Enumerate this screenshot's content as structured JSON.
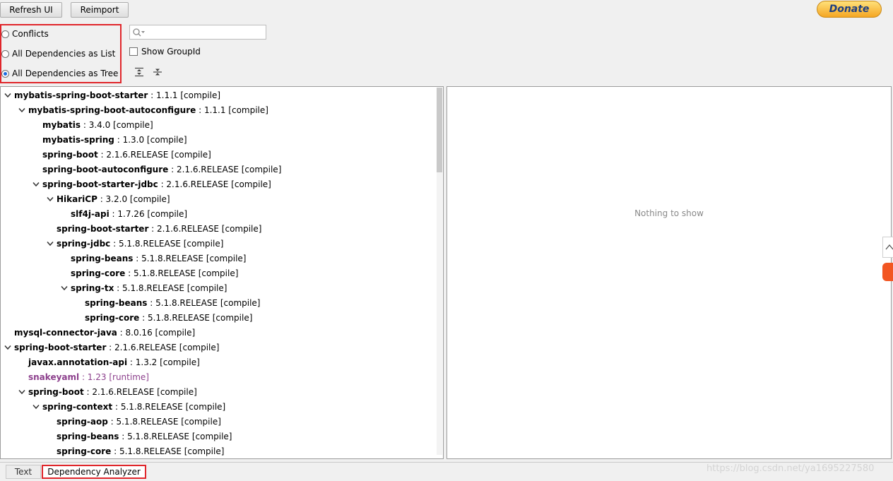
{
  "toolbar": {
    "refresh_label": "Refresh UI",
    "reimport_label": "Reimport",
    "donate_label": "Donate"
  },
  "view_mode": {
    "options": [
      "Conflicts",
      "All Dependencies as List",
      "All Dependencies as Tree"
    ],
    "selected": "All Dependencies as Tree"
  },
  "search": {
    "value": "",
    "placeholder": ""
  },
  "show_groupid": {
    "label": "Show GroupId",
    "checked": false
  },
  "tree": [
    {
      "name": "mybatis-spring-boot-starter",
      "version": " : 1.1.1 [compile]",
      "depth": 0,
      "expanded": true
    },
    {
      "name": "mybatis-spring-boot-autoconfigure",
      "version": " : 1.1.1 [compile]",
      "depth": 1,
      "expanded": true
    },
    {
      "name": "mybatis",
      "version": " : 3.4.0 [compile]",
      "depth": 2
    },
    {
      "name": "mybatis-spring",
      "version": " : 1.3.0 [compile]",
      "depth": 2
    },
    {
      "name": "spring-boot",
      "version": " : 2.1.6.RELEASE [compile]",
      "depth": 2
    },
    {
      "name": "spring-boot-autoconfigure",
      "version": " : 2.1.6.RELEASE [compile]",
      "depth": 2
    },
    {
      "name": "spring-boot-starter-jdbc",
      "version": " : 2.1.6.RELEASE [compile]",
      "depth": 2,
      "expanded": true
    },
    {
      "name": "HikariCP",
      "version": " : 3.2.0 [compile]",
      "depth": 3,
      "expanded": true
    },
    {
      "name": "slf4j-api",
      "version": " : 1.7.26 [compile]",
      "depth": 4
    },
    {
      "name": "spring-boot-starter",
      "version": " : 2.1.6.RELEASE [compile]",
      "depth": 3
    },
    {
      "name": "spring-jdbc",
      "version": " : 5.1.8.RELEASE [compile]",
      "depth": 3,
      "expanded": true
    },
    {
      "name": "spring-beans",
      "version": " : 5.1.8.RELEASE [compile]",
      "depth": 4
    },
    {
      "name": "spring-core",
      "version": " : 5.1.8.RELEASE [compile]",
      "depth": 4
    },
    {
      "name": "spring-tx",
      "version": " : 5.1.8.RELEASE [compile]",
      "depth": 4,
      "expanded": true
    },
    {
      "name": "spring-beans",
      "version": " : 5.1.8.RELEASE [compile]",
      "depth": 5
    },
    {
      "name": "spring-core",
      "version": " : 5.1.8.RELEASE [compile]",
      "depth": 5
    },
    {
      "name": "mysql-connector-java",
      "version": " : 8.0.16 [compile]",
      "depth": 0
    },
    {
      "name": "spring-boot-starter",
      "version": " : 2.1.6.RELEASE [compile]",
      "depth": 0,
      "expanded": true
    },
    {
      "name": "javax.annotation-api",
      "version": " : 1.3.2 [compile]",
      "depth": 1
    },
    {
      "name": "snakeyaml",
      "version": " : 1.23 [runtime]",
      "depth": 1,
      "runtime": true
    },
    {
      "name": "spring-boot",
      "version": " : 2.1.6.RELEASE [compile]",
      "depth": 1,
      "expanded": true
    },
    {
      "name": "spring-context",
      "version": " : 5.1.8.RELEASE [compile]",
      "depth": 2,
      "expanded": true
    },
    {
      "name": "spring-aop",
      "version": " : 5.1.8.RELEASE [compile]",
      "depth": 3
    },
    {
      "name": "spring-beans",
      "version": " : 5.1.8.RELEASE [compile]",
      "depth": 3
    },
    {
      "name": "spring-core",
      "version": " : 5.1.8.RELEASE [compile]",
      "depth": 3
    }
  ],
  "detail": {
    "empty_message": "Nothing to show"
  },
  "tabs": [
    {
      "label": "Text",
      "active": false
    },
    {
      "label": "Dependency Analyzer",
      "active": true
    }
  ],
  "watermark": "https://blog.csdn.net/ya1695227580",
  "colors": {
    "highlight_border": "#e0262b",
    "runtime_scope": "#8c3f8c",
    "radio_selected": "#1c6ce0",
    "donate_text": "#1e3f80"
  }
}
